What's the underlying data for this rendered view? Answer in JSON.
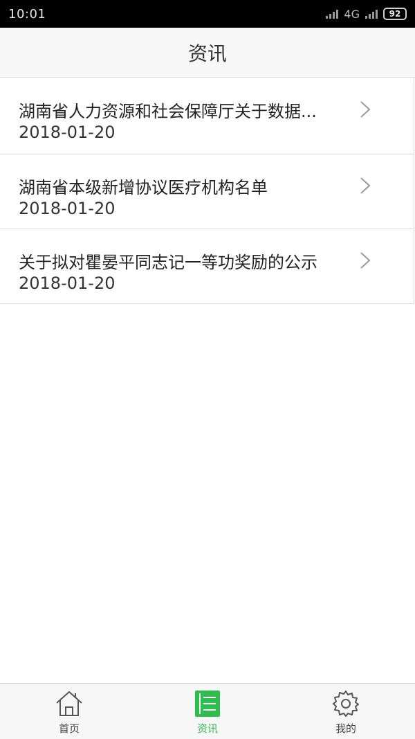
{
  "status_bar": {
    "time": "10:01",
    "network": "4G",
    "battery": "92"
  },
  "header": {
    "title": "资讯"
  },
  "news": [
    {
      "title": "湖南省人力资源和社会保障厅关于数据...",
      "date": "2018-01-20"
    },
    {
      "title": "湖南省本级新增协议医疗机构名单",
      "date": "2018-01-20"
    },
    {
      "title": "关于拟对瞿晏平同志记一等功奖励的公示",
      "date": "2018-01-20"
    }
  ],
  "bottom_nav": {
    "items": [
      {
        "label": "首页",
        "icon": "home-icon",
        "active": false
      },
      {
        "label": "资讯",
        "icon": "news-icon",
        "active": true
      },
      {
        "label": "我的",
        "icon": "gear-icon",
        "active": false
      }
    ]
  },
  "colors": {
    "accent": "#2dbe4f",
    "header_bg": "#f7f7f7",
    "divider": "#d9d9d9"
  }
}
